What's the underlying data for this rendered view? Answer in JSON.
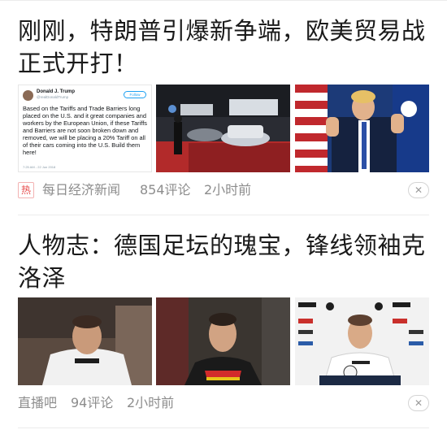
{
  "articles": [
    {
      "headline": "刚刚，特朗普引爆新争端，欧美贸易战正式开打！",
      "hot_tag": "热",
      "source": "每日经济新闻",
      "comments": "854评论",
      "time": "2小时前",
      "tweet": {
        "name": "Donald J. Trump",
        "handle": "@realDonaldTrump",
        "follow_label": "Follow",
        "text": "Based on the Tariffs and Trade Barriers long placed on the U.S. and it great companies and workers by the European Union, if these Tariffs and Barriers are not soon broken down and removed, we will be placing a 20% Tariff on all of their cars coming into the U.S. Build them here!",
        "timestamp": "7:25 AM - 22 Jun 2018"
      }
    },
    {
      "headline": "人物志：德国足坛的瑰宝，锋线领袖克洛泽",
      "source": "直播吧",
      "comments": "94评论",
      "time": "2小时前"
    }
  ],
  "icons": {
    "dismiss": "close-icon",
    "hot": "hot-badge"
  },
  "colors": {
    "hot_red": "#e74c4c",
    "meta_gray": "#8d8d8d",
    "divider": "#ececec"
  }
}
